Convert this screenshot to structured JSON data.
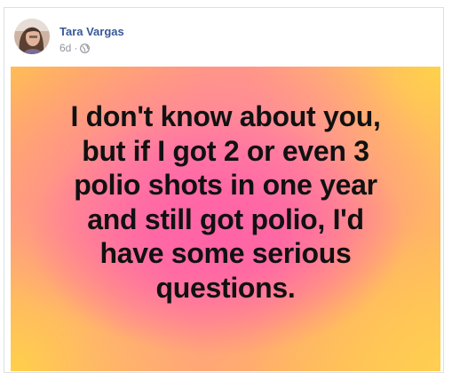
{
  "post": {
    "author": "Tara Vargas",
    "timestamp": "6d",
    "separator": "·",
    "privacy_icon": "globe-icon",
    "avatar_icon": "profile-photo",
    "image_text_lines": [
      "I don't know about you,",
      "but if I got 2 or even 3",
      "polio shots in one year",
      "and still got polio, I'd",
      "have some serious",
      "questions."
    ]
  },
  "colors": {
    "author_link": "#385898",
    "meta_text": "#90949c",
    "border": "#dddfe2",
    "image_pink": "#ff63a6",
    "image_yellow": "#ffd24a",
    "image_text": "#111111"
  }
}
